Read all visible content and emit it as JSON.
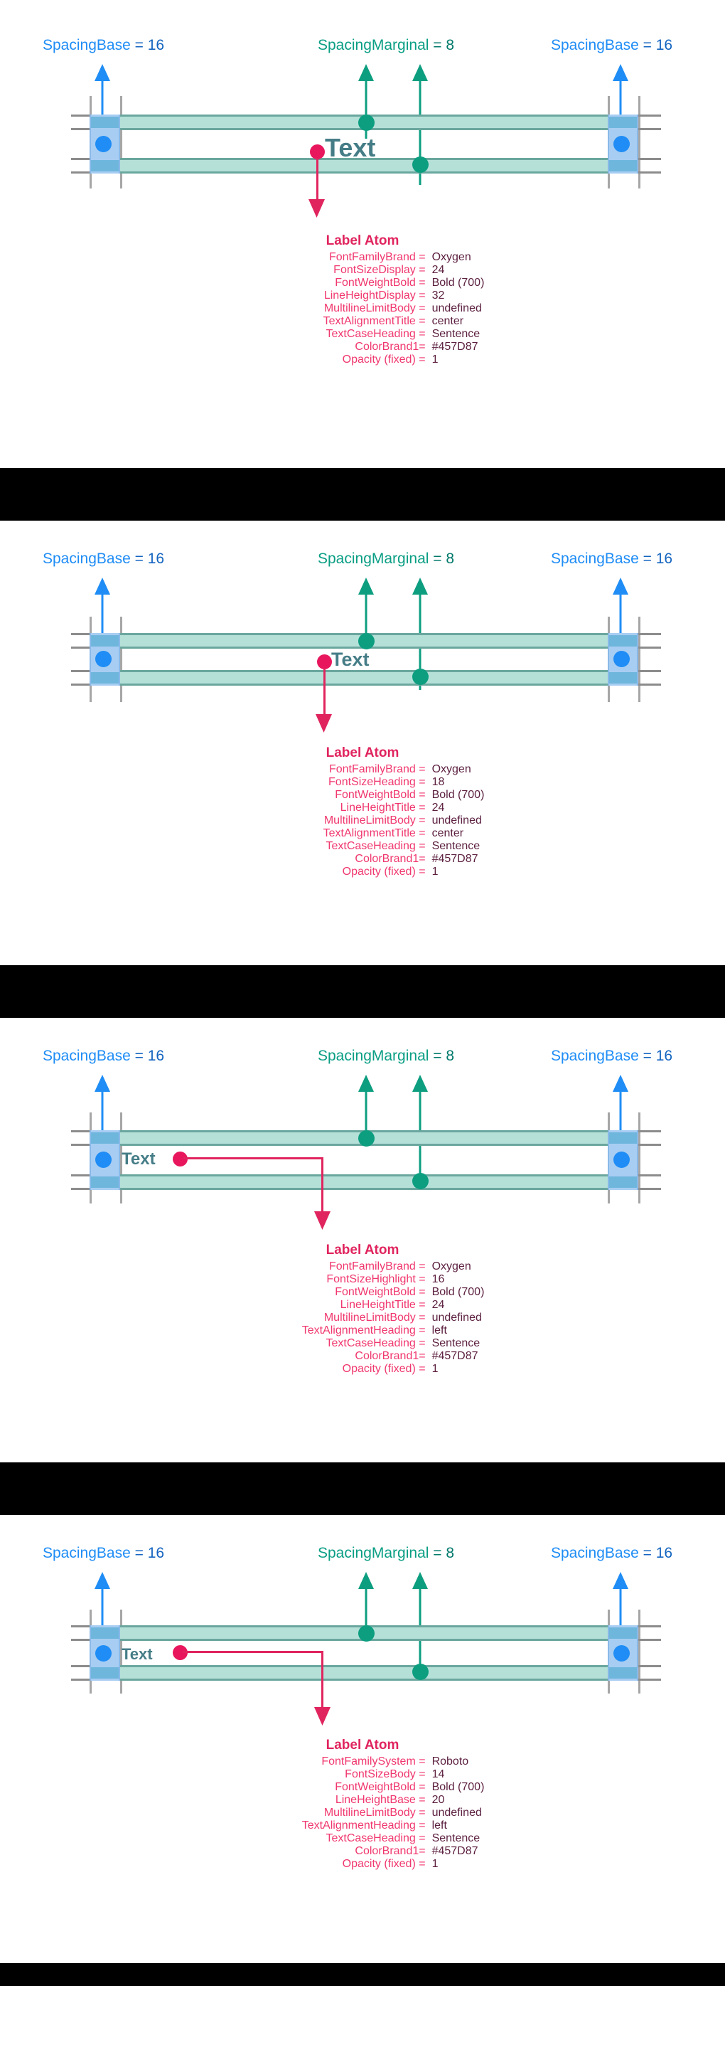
{
  "colors": {
    "brand1": "#457D87",
    "spacing_base_color": "#1f8df5",
    "spacing_marginal_color": "#0a9e84",
    "label_color": "#e0245e",
    "separator": "#000000"
  },
  "header_labels": {
    "left": {
      "key": "SpacingBase",
      "eq": "=",
      "value": "16"
    },
    "center": {
      "key": "SpacingMarginal",
      "eq": "=",
      "value": "8"
    },
    "right": {
      "key": "SpacingBase",
      "eq": "=",
      "value": "16"
    }
  },
  "sample_text": "Text",
  "label_title": "Label Atom",
  "panels": [
    {
      "id": "panel-display-24",
      "align": "center",
      "sample_font_size": "36px",
      "specs": [
        {
          "key": "FontFamilyBrand",
          "eq": "=",
          "value": "Oxygen"
        },
        {
          "key": "FontSizeDisplay",
          "eq": "=",
          "value": "24"
        },
        {
          "key": "FontWeightBold",
          "eq": "=",
          "value": "Bold (700)"
        },
        {
          "key": "LineHeightDisplay",
          "eq": "=",
          "value": "32"
        },
        {
          "key": "MultilineLimitBody",
          "eq": "=",
          "value": "undefined"
        },
        {
          "key": "TextAlignmentTitle",
          "eq": "=",
          "value": "center"
        },
        {
          "key": "TextCaseHeading",
          "eq": "=",
          "value": "Sentence"
        },
        {
          "key": "ColorBrand1",
          "eq": "=",
          "value": "#457D87"
        },
        {
          "key": "Opacity (fixed)",
          "eq": "=",
          "value": "1"
        }
      ]
    },
    {
      "id": "panel-heading-18",
      "align": "center",
      "sample_font_size": "27px",
      "specs": [
        {
          "key": "FontFamilyBrand",
          "eq": "=",
          "value": "Oxygen"
        },
        {
          "key": "FontSizeHeading",
          "eq": "=",
          "value": "18"
        },
        {
          "key": "FontWeightBold",
          "eq": "=",
          "value": "Bold (700)"
        },
        {
          "key": "LineHeightTitle",
          "eq": "=",
          "value": "24"
        },
        {
          "key": "MultilineLimitBody",
          "eq": "=",
          "value": "undefined"
        },
        {
          "key": "TextAlignmentTitle",
          "eq": "=",
          "value": "center"
        },
        {
          "key": "TextCaseHeading",
          "eq": "=",
          "value": "Sentence"
        },
        {
          "key": "ColorBrand1",
          "eq": "=",
          "value": "#457D87"
        },
        {
          "key": "Opacity (fixed)",
          "eq": "=",
          "value": "1"
        }
      ]
    },
    {
      "id": "panel-highlight-16",
      "align": "left",
      "sample_font_size": "24px",
      "specs": [
        {
          "key": "FontFamilyBrand",
          "eq": "=",
          "value": "Oxygen"
        },
        {
          "key": "FontSizeHighlight",
          "eq": "=",
          "value": "16"
        },
        {
          "key": "FontWeightBold",
          "eq": "=",
          "value": "Bold (700)"
        },
        {
          "key": "LineHeightTitle",
          "eq": "=",
          "value": "24"
        },
        {
          "key": "MultilineLimitBody",
          "eq": "=",
          "value": "undefined"
        },
        {
          "key": "TextAlignmentHeading",
          "eq": "=",
          "value": "left"
        },
        {
          "key": "TextCaseHeading",
          "eq": "=",
          "value": "Sentence"
        },
        {
          "key": "ColorBrand1",
          "eq": "=",
          "value": "#457D87"
        },
        {
          "key": "Opacity (fixed)",
          "eq": "=",
          "value": "1"
        }
      ]
    },
    {
      "id": "panel-body-14",
      "align": "left",
      "sample_font_size": "22px",
      "specs": [
        {
          "key": "FontFamilySystem",
          "eq": "=",
          "value": "Roboto"
        },
        {
          "key": "FontSizeBody",
          "eq": "=",
          "value": "14"
        },
        {
          "key": "FontWeightBold",
          "eq": "=",
          "value": "Bold (700)"
        },
        {
          "key": "LineHeightBase",
          "eq": "=",
          "value": "20"
        },
        {
          "key": "MultilineLimitBody",
          "eq": "=",
          "value": "undefined"
        },
        {
          "key": "TextAlignmentHeading",
          "eq": "=",
          "value": "left"
        },
        {
          "key": "TextCaseHeading",
          "eq": "=",
          "value": "Sentence"
        },
        {
          "key": "ColorBrand1",
          "eq": "=",
          "value": "#457D87"
        },
        {
          "key": "Opacity (fixed)",
          "eq": "=",
          "value": "1"
        }
      ]
    }
  ]
}
